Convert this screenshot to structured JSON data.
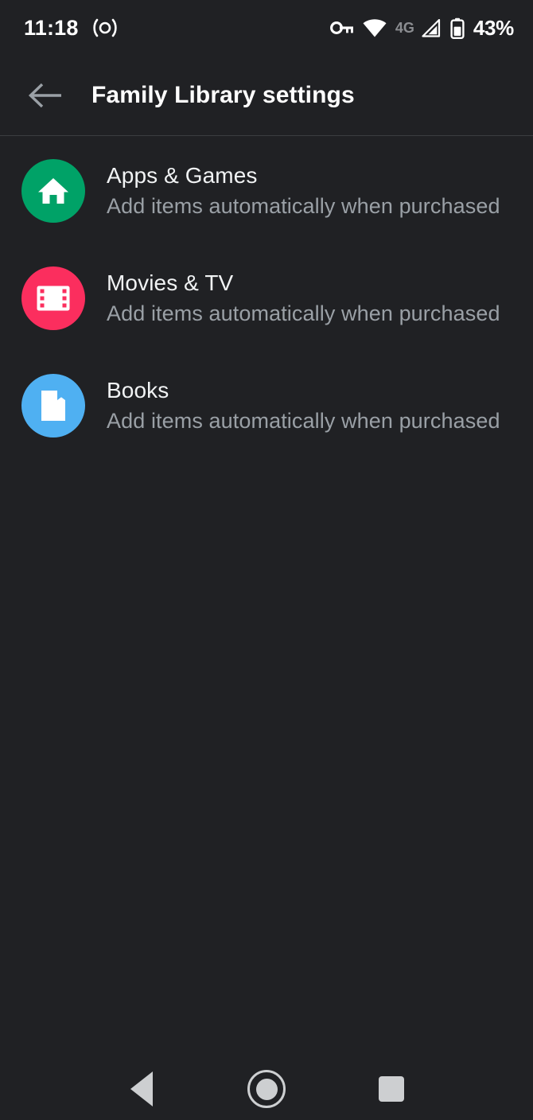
{
  "theme": {
    "background": "#202124",
    "divider": "#3b3d40",
    "title_color": "#ffffff",
    "subtitle_color": "#9aa0a6",
    "nav_icon_color": "#cdcfd1"
  },
  "status_bar": {
    "time": "11:18",
    "left_icons": [
      {
        "name": "hotspot-icon",
        "glyph": "(o)"
      }
    ],
    "right_icons": [
      {
        "name": "vpn-key-icon"
      },
      {
        "name": "wifi-icon"
      },
      {
        "name": "mobile-network-type-label",
        "label": "4G"
      },
      {
        "name": "cellular-signal-icon"
      },
      {
        "name": "battery-icon"
      }
    ],
    "battery_percent": "43%"
  },
  "app_bar": {
    "back_icon": "back-arrow-icon",
    "title": "Family Library settings"
  },
  "list": {
    "items": [
      {
        "title": "Apps & Games",
        "subtitle": "Add items automatically when purchased",
        "icon": "home-icon",
        "icon_color": "#00a267"
      },
      {
        "title": "Movies & TV",
        "subtitle": "Add items automatically when purchased",
        "icon": "film-strip-icon",
        "icon_color": "#fb2e5e"
      },
      {
        "title": "Books",
        "subtitle": "Add items automatically when purchased",
        "icon": "book-icon",
        "icon_color": "#4fb0f2"
      }
    ]
  },
  "nav_bar": {
    "back_label": "Back",
    "home_label": "Home",
    "recents_label": "Recent apps"
  }
}
